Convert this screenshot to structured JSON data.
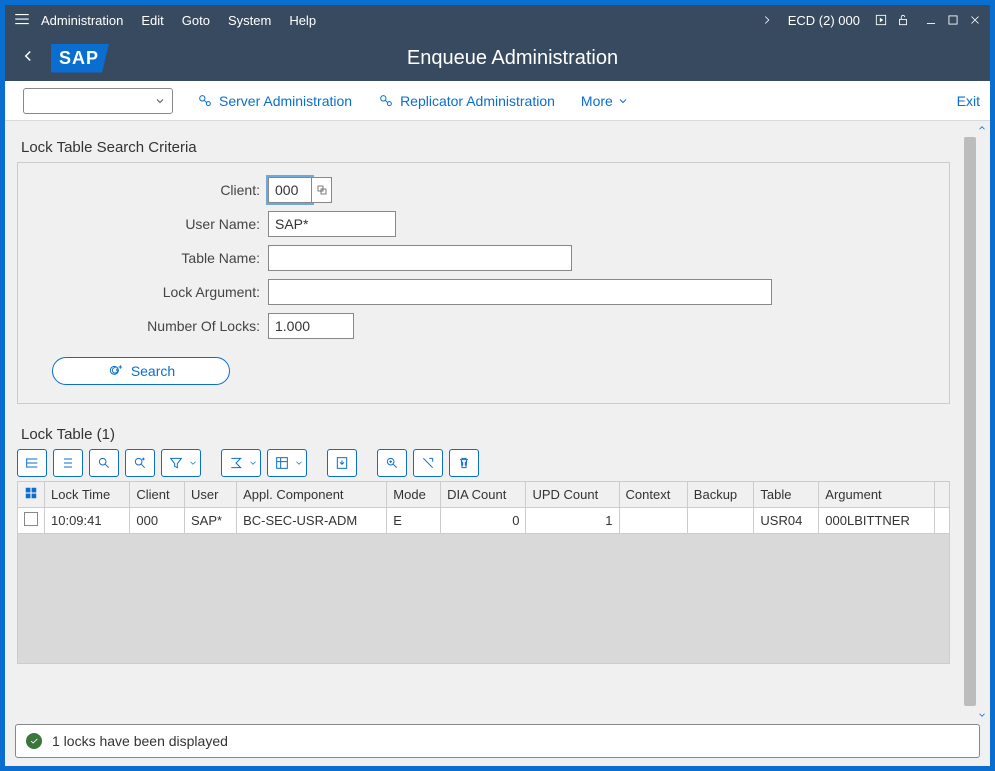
{
  "menu": {
    "items": [
      "Administration",
      "Edit",
      "Goto",
      "System",
      "Help"
    ],
    "system_id": "ECD (2) 000"
  },
  "title": "Enqueue Administration",
  "logo": "SAP",
  "toolbar": {
    "server_admin": "Server Administration",
    "replicator_admin": "Replicator Administration",
    "more": "More",
    "exit": "Exit"
  },
  "search": {
    "section_title": "Lock Table Search Criteria",
    "labels": {
      "client": "Client:",
      "user": "User Name:",
      "table": "Table Name:",
      "arg": "Lock Argument:",
      "num": "Number Of Locks:"
    },
    "values": {
      "client": "000",
      "user": "SAP*",
      "table": "",
      "arg": "",
      "num": "1.000"
    },
    "button": "Search"
  },
  "table": {
    "title": "Lock Table (1)",
    "columns": [
      "Lock Time",
      "Client",
      "User",
      "Appl. Component",
      "Mode",
      "DIA Count",
      "UPD Count",
      "Context",
      "Backup",
      "Table",
      "Argument"
    ],
    "rows": [
      {
        "time": "10:09:41",
        "client": "000",
        "user": "SAP*",
        "comp": "BC-SEC-USR-ADM",
        "mode": "E",
        "dia": "0",
        "upd": "1",
        "ctx": "",
        "bkp": "",
        "tbl": "USR04",
        "arg": "000LBITTNER"
      }
    ]
  },
  "status": "1 locks have been displayed"
}
